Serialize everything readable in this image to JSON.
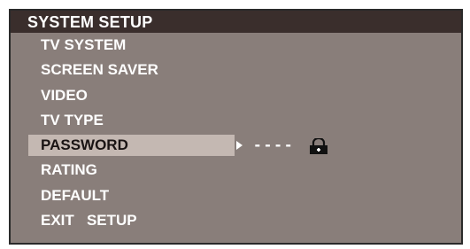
{
  "header": {
    "title": "SYSTEM SETUP"
  },
  "menu": {
    "items": [
      {
        "label": "TV SYSTEM"
      },
      {
        "label": "SCREEN SAVER"
      },
      {
        "label": "VIDEO"
      },
      {
        "label": "TV TYPE"
      },
      {
        "label": "PASSWORD"
      },
      {
        "label": "RATING"
      },
      {
        "label": "DEFAULT"
      },
      {
        "label": "EXIT   SETUP"
      }
    ],
    "selected_index": 4
  },
  "password": {
    "value_mask": "----",
    "arrow_icon": "right-arrow-icon",
    "lock_icon": "lock-icon"
  },
  "colors": {
    "panel": "#897e7a",
    "title_bar": "#3a2e2c",
    "highlight": "#c4b8b2",
    "text": "#ffffff"
  }
}
